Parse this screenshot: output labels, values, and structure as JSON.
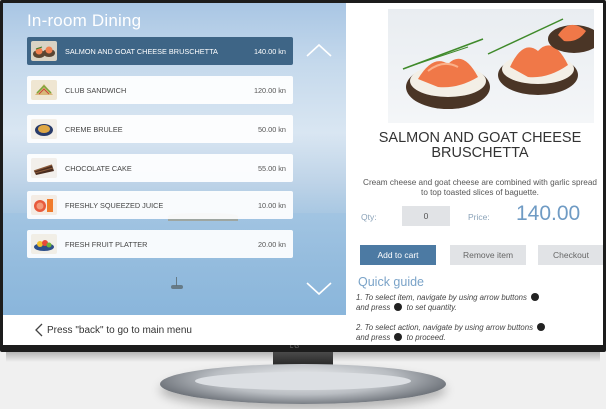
{
  "app": {
    "title": "In-room Dining",
    "brand": "LG"
  },
  "colors": {
    "selected_row": "#3e6586",
    "accent_blue": "#6f9bc4",
    "primary_button": "#4c7aa3"
  },
  "menu": {
    "items": [
      {
        "name": "SALMON AND GOAT CHEESE BRUSCHETTA",
        "price": "140.00 kn",
        "icon": "bruschetta-thumbnail",
        "selected": true
      },
      {
        "name": "CLUB SANDWICH",
        "price": "120.00 kn",
        "icon": "sandwich-thumbnail",
        "selected": false
      },
      {
        "name": "CREME BRULEE",
        "price": "50.00 kn",
        "icon": "creme-brulee-thumbnail",
        "selected": false
      },
      {
        "name": "CHOCOLATE CAKE",
        "price": "55.00 kn",
        "icon": "chocolate-cake-thumbnail",
        "selected": false
      },
      {
        "name": "FRESHLY SQUEEZED JUICE",
        "price": "10.00 kn",
        "icon": "juice-thumbnail",
        "selected": false
      },
      {
        "name": "FRESH FRUIT PLATTER",
        "price": "20.00 kn",
        "icon": "fruit-platter-thumbnail",
        "selected": false
      }
    ],
    "scroll_up_icon": "chevron-up-icon",
    "scroll_down_icon": "chevron-down-icon"
  },
  "footer": {
    "back_text": "Press \"back\" to go to main menu",
    "back_icon": "chevron-left-icon"
  },
  "detail": {
    "photo_icon": "bruschetta-photo",
    "title": "SALMON AND GOAT CHEESE BRUSCHETTA",
    "description": "Cream cheese and goat cheese are combined with garlic spread to top toasted slices of baguette.",
    "qty_label": "Qty:",
    "qty_value": "0",
    "price_label": "Price:",
    "price_value": "140.00"
  },
  "actions": {
    "add_to_cart": "Add to cart",
    "remove_item": "Remove item",
    "checkout": "Checkout"
  },
  "guide": {
    "title": "Quick guide",
    "line1_a": "1. To select item, navigate by using arrow buttons",
    "line1_b": "and press",
    "line1_c": "to set quantity.",
    "line2_a": "2. To select action, navigate by using arrow buttons",
    "line2_b": "and press",
    "line2_c": "to proceed."
  }
}
